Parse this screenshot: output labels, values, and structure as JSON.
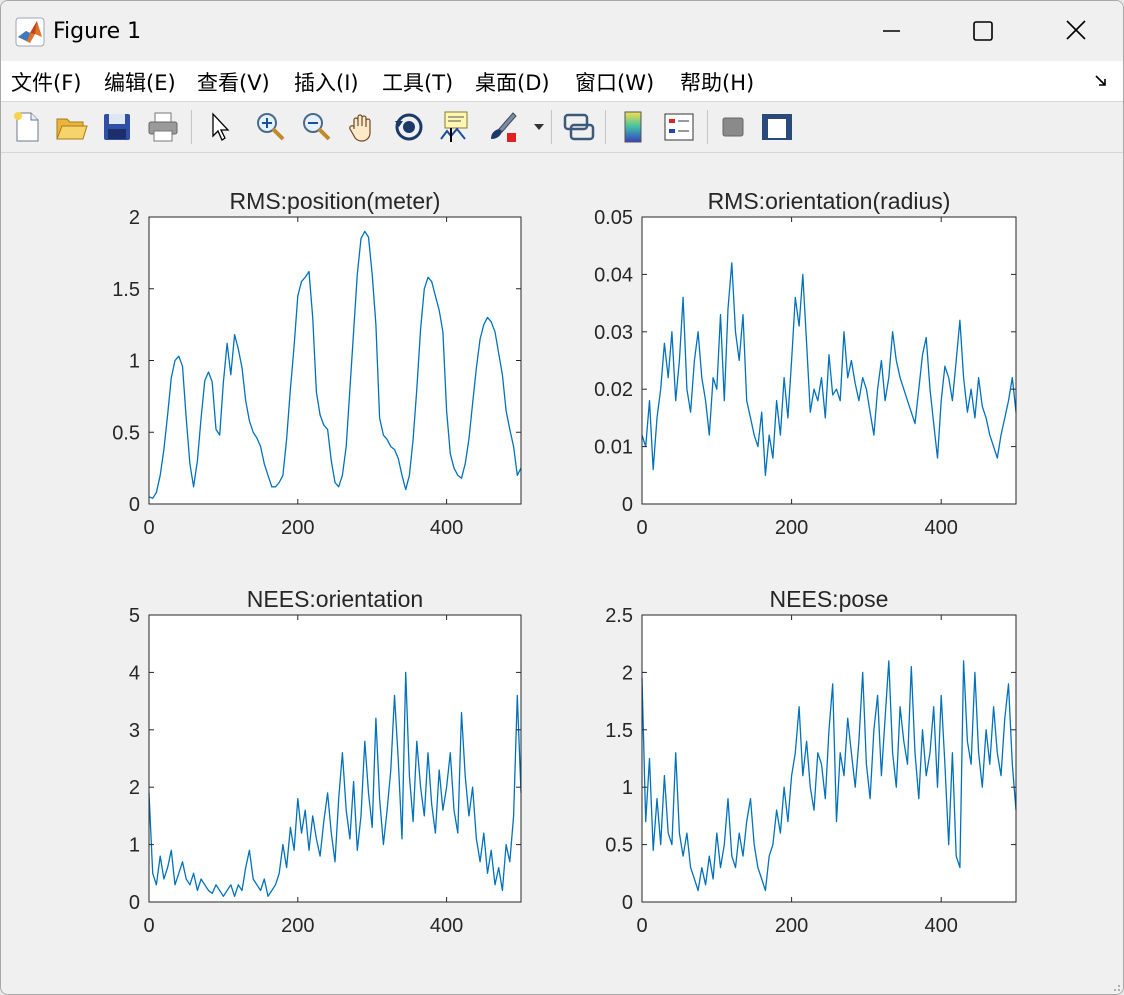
{
  "window": {
    "title": "Figure 1",
    "controls": {
      "minimize": "minimize",
      "maximize": "maximize",
      "close": "close"
    }
  },
  "menu": [
    {
      "label": "文件(F)"
    },
    {
      "label": "编辑(E)"
    },
    {
      "label": "查看(V)"
    },
    {
      "label": "插入(I)"
    },
    {
      "label": "工具(T)"
    },
    {
      "label": "桌面(D)"
    },
    {
      "label": "窗口(W)"
    },
    {
      "label": "帮助(H)"
    }
  ],
  "toolbar": [
    {
      "icon": "new-figure-icon"
    },
    {
      "icon": "open-file-icon"
    },
    {
      "icon": "save-icon"
    },
    {
      "icon": "print-icon"
    },
    {
      "icon": "select-arrow-icon"
    },
    {
      "icon": "zoom-in-icon"
    },
    {
      "icon": "zoom-out-icon"
    },
    {
      "icon": "pan-hand-icon"
    },
    {
      "icon": "rotate-3d-icon"
    },
    {
      "icon": "data-cursor-icon"
    },
    {
      "icon": "brush-icon"
    },
    {
      "icon": "link-plot-icon"
    },
    {
      "icon": "colorbar-icon"
    },
    {
      "icon": "legend-icon"
    },
    {
      "icon": "hide-plot-tools-icon"
    },
    {
      "icon": "show-plot-tools-icon"
    }
  ],
  "colors": {
    "line": "#0072BD",
    "axes_bg": "#ffffff",
    "axes_edge": "#262626",
    "figure_bg": "#f0f0f0"
  },
  "chart_data": [
    {
      "type": "line",
      "title": "RMS:position(meter)",
      "xlim": [
        0,
        500
      ],
      "ylim": [
        0,
        2
      ],
      "xticks": [
        0,
        200,
        400
      ],
      "yticks": [
        0,
        0.5,
        1,
        1.5,
        2
      ],
      "xtick_labels": [
        "0",
        "200",
        "400"
      ],
      "ytick_labels": [
        "0",
        "0.5",
        "1",
        "1.5",
        "2"
      ],
      "x": [
        0,
        5,
        10,
        15,
        20,
        25,
        30,
        35,
        40,
        45,
        50,
        55,
        60,
        65,
        70,
        75,
        80,
        85,
        90,
        95,
        100,
        105,
        110,
        115,
        120,
        125,
        130,
        135,
        140,
        145,
        150,
        155,
        160,
        165,
        170,
        175,
        180,
        185,
        190,
        195,
        200,
        205,
        210,
        215,
        220,
        225,
        230,
        235,
        240,
        245,
        250,
        255,
        260,
        265,
        270,
        275,
        280,
        285,
        290,
        295,
        300,
        305,
        310,
        315,
        320,
        325,
        330,
        335,
        340,
        345,
        350,
        355,
        360,
        365,
        370,
        375,
        380,
        385,
        390,
        395,
        400,
        405,
        410,
        415,
        420,
        425,
        430,
        435,
        440,
        445,
        450,
        455,
        460,
        465,
        470,
        475,
        480,
        485,
        490,
        495,
        500
      ],
      "y": [
        0.05,
        0.04,
        0.08,
        0.2,
        0.38,
        0.62,
        0.88,
        1.0,
        1.03,
        0.96,
        0.6,
        0.28,
        0.12,
        0.3,
        0.6,
        0.86,
        0.92,
        0.85,
        0.52,
        0.48,
        0.85,
        1.12,
        0.9,
        1.18,
        1.08,
        0.95,
        0.72,
        0.58,
        0.5,
        0.46,
        0.4,
        0.28,
        0.2,
        0.12,
        0.12,
        0.15,
        0.2,
        0.45,
        0.8,
        1.1,
        1.45,
        1.55,
        1.58,
        1.62,
        1.3,
        0.78,
        0.62,
        0.55,
        0.52,
        0.3,
        0.15,
        0.12,
        0.2,
        0.4,
        0.8,
        1.2,
        1.6,
        1.85,
        1.9,
        1.86,
        1.6,
        1.25,
        0.6,
        0.48,
        0.45,
        0.4,
        0.38,
        0.32,
        0.2,
        0.1,
        0.2,
        0.45,
        0.8,
        1.22,
        1.5,
        1.58,
        1.55,
        1.45,
        1.35,
        1.2,
        0.65,
        0.35,
        0.25,
        0.2,
        0.18,
        0.28,
        0.45,
        0.7,
        0.95,
        1.15,
        1.25,
        1.3,
        1.27,
        1.2,
        1.05,
        0.9,
        0.65,
        0.52,
        0.4,
        0.2,
        0.25
      ]
    },
    {
      "type": "line",
      "title": "RMS:orientation(radius)",
      "xlim": [
        0,
        500
      ],
      "ylim": [
        0,
        0.05
      ],
      "xticks": [
        0,
        200,
        400
      ],
      "yticks": [
        0,
        0.01,
        0.02,
        0.03,
        0.04,
        0.05
      ],
      "xtick_labels": [
        "0",
        "200",
        "400"
      ],
      "ytick_labels": [
        "0",
        "0.01",
        "0.02",
        "0.03",
        "0.04",
        "0.05"
      ],
      "x": [
        0,
        5,
        10,
        15,
        20,
        25,
        30,
        35,
        40,
        45,
        50,
        55,
        60,
        65,
        70,
        75,
        80,
        85,
        90,
        95,
        100,
        105,
        110,
        115,
        120,
        125,
        130,
        135,
        140,
        145,
        150,
        155,
        160,
        165,
        170,
        175,
        180,
        185,
        190,
        195,
        200,
        205,
        210,
        215,
        220,
        225,
        230,
        235,
        240,
        245,
        250,
        255,
        260,
        265,
        270,
        275,
        280,
        285,
        290,
        295,
        300,
        305,
        310,
        315,
        320,
        325,
        330,
        335,
        340,
        345,
        350,
        355,
        360,
        365,
        370,
        375,
        380,
        385,
        390,
        395,
        400,
        405,
        410,
        415,
        420,
        425,
        430,
        435,
        440,
        445,
        450,
        455,
        460,
        465,
        470,
        475,
        480,
        485,
        490,
        495,
        500
      ],
      "y": [
        0.012,
        0.01,
        0.018,
        0.006,
        0.015,
        0.02,
        0.028,
        0.022,
        0.03,
        0.018,
        0.025,
        0.036,
        0.02,
        0.016,
        0.025,
        0.03,
        0.022,
        0.018,
        0.012,
        0.022,
        0.02,
        0.033,
        0.018,
        0.034,
        0.042,
        0.03,
        0.025,
        0.033,
        0.018,
        0.015,
        0.012,
        0.01,
        0.016,
        0.005,
        0.012,
        0.008,
        0.018,
        0.012,
        0.022,
        0.015,
        0.025,
        0.036,
        0.031,
        0.04,
        0.028,
        0.016,
        0.02,
        0.018,
        0.022,
        0.015,
        0.026,
        0.019,
        0.02,
        0.018,
        0.03,
        0.022,
        0.025,
        0.021,
        0.018,
        0.022,
        0.02,
        0.016,
        0.012,
        0.02,
        0.025,
        0.018,
        0.022,
        0.03,
        0.025,
        0.022,
        0.02,
        0.018,
        0.016,
        0.014,
        0.02,
        0.026,
        0.029,
        0.02,
        0.014,
        0.008,
        0.018,
        0.024,
        0.022,
        0.018,
        0.025,
        0.032,
        0.022,
        0.016,
        0.02,
        0.015,
        0.022,
        0.017,
        0.015,
        0.012,
        0.01,
        0.008,
        0.012,
        0.015,
        0.018,
        0.022,
        0.016
      ]
    },
    {
      "type": "line",
      "title": "NEES:orientation",
      "xlim": [
        0,
        500
      ],
      "ylim": [
        0,
        5
      ],
      "xticks": [
        0,
        200,
        400
      ],
      "yticks": [
        0,
        1,
        2,
        3,
        4,
        5
      ],
      "xtick_labels": [
        "0",
        "200",
        "400"
      ],
      "ytick_labels": [
        "0",
        "1",
        "2",
        "3",
        "4",
        "5"
      ],
      "x": [
        0,
        5,
        10,
        15,
        20,
        25,
        30,
        35,
        40,
        45,
        50,
        55,
        60,
        65,
        70,
        75,
        80,
        85,
        90,
        95,
        100,
        105,
        110,
        115,
        120,
        125,
        130,
        135,
        140,
        145,
        150,
        155,
        160,
        165,
        170,
        175,
        180,
        185,
        190,
        195,
        200,
        205,
        210,
        215,
        220,
        225,
        230,
        235,
        240,
        245,
        250,
        255,
        260,
        265,
        270,
        275,
        280,
        285,
        290,
        295,
        300,
        305,
        310,
        315,
        320,
        325,
        330,
        335,
        340,
        345,
        350,
        355,
        360,
        365,
        370,
        375,
        380,
        385,
        390,
        395,
        400,
        405,
        410,
        415,
        420,
        425,
        430,
        435,
        440,
        445,
        450,
        455,
        460,
        465,
        470,
        475,
        480,
        485,
        490,
        495,
        500
      ],
      "y": [
        1.9,
        0.5,
        0.3,
        0.8,
        0.4,
        0.6,
        0.9,
        0.3,
        0.5,
        0.7,
        0.4,
        0.3,
        0.5,
        0.2,
        0.4,
        0.3,
        0.2,
        0.15,
        0.3,
        0.2,
        0.1,
        0.2,
        0.3,
        0.1,
        0.3,
        0.2,
        0.6,
        0.9,
        0.4,
        0.3,
        0.2,
        0.4,
        0.1,
        0.2,
        0.3,
        0.5,
        1.0,
        0.6,
        1.3,
        0.9,
        1.8,
        1.2,
        1.6,
        0.9,
        1.5,
        1.1,
        0.8,
        1.4,
        1.9,
        1.2,
        0.7,
        1.8,
        2.6,
        1.6,
        1.1,
        2.1,
        0.9,
        1.5,
        2.8,
        1.9,
        1.3,
        3.2,
        1.8,
        1.0,
        1.6,
        2.3,
        3.6,
        2.5,
        1.1,
        4.0,
        2.2,
        1.4,
        2.8,
        2.0,
        1.5,
        2.6,
        1.7,
        1.2,
        2.3,
        1.6,
        2.0,
        2.6,
        1.6,
        1.2,
        3.3,
        2.2,
        1.5,
        2.0,
        1.1,
        0.7,
        1.2,
        0.5,
        0.9,
        0.3,
        0.6,
        0.2,
        1.0,
        0.7,
        1.5,
        3.6,
        1.9
      ]
    },
    {
      "type": "line",
      "title": "NEES:pose",
      "xlim": [
        0,
        500
      ],
      "ylim": [
        0,
        2.5
      ],
      "xticks": [
        0,
        200,
        400
      ],
      "yticks": [
        0,
        0.5,
        1,
        1.5,
        2,
        2.5
      ],
      "xtick_labels": [
        "0",
        "200",
        "400"
      ],
      "ytick_labels": [
        "0",
        "0.5",
        "1",
        "1.5",
        "2",
        "2.5"
      ],
      "x": [
        0,
        5,
        10,
        15,
        20,
        25,
        30,
        35,
        40,
        45,
        50,
        55,
        60,
        65,
        70,
        75,
        80,
        85,
        90,
        95,
        100,
        105,
        110,
        115,
        120,
        125,
        130,
        135,
        140,
        145,
        150,
        155,
        160,
        165,
        170,
        175,
        180,
        185,
        190,
        195,
        200,
        205,
        210,
        215,
        220,
        225,
        230,
        235,
        240,
        245,
        250,
        255,
        260,
        265,
        270,
        275,
        280,
        285,
        290,
        295,
        300,
        305,
        310,
        315,
        320,
        325,
        330,
        335,
        340,
        345,
        350,
        355,
        360,
        365,
        370,
        375,
        380,
        385,
        390,
        395,
        400,
        405,
        410,
        415,
        420,
        425,
        430,
        435,
        440,
        445,
        450,
        455,
        460,
        465,
        470,
        475,
        480,
        485,
        490,
        495,
        500
      ],
      "y": [
        1.95,
        0.7,
        1.25,
        0.45,
        0.9,
        0.5,
        1.1,
        0.6,
        0.5,
        1.3,
        0.6,
        0.4,
        0.6,
        0.3,
        0.2,
        0.1,
        0.3,
        0.15,
        0.4,
        0.2,
        0.6,
        0.3,
        0.5,
        0.9,
        0.4,
        0.3,
        0.6,
        0.4,
        0.7,
        0.9,
        0.5,
        0.3,
        0.2,
        0.1,
        0.4,
        0.5,
        0.8,
        0.6,
        1.0,
        0.7,
        1.1,
        1.3,
        1.7,
        1.1,
        1.4,
        1.0,
        0.8,
        1.3,
        1.2,
        0.9,
        1.5,
        1.9,
        0.7,
        1.3,
        1.1,
        1.6,
        1.3,
        1.0,
        1.4,
        2.0,
        1.2,
        0.9,
        1.5,
        1.8,
        1.1,
        1.6,
        2.1,
        1.3,
        1.0,
        1.7,
        1.4,
        1.2,
        2.05,
        1.3,
        0.9,
        1.5,
        1.1,
        1.3,
        1.7,
        1.0,
        1.8,
        1.2,
        0.5,
        1.3,
        0.4,
        0.3,
        2.1,
        1.4,
        1.2,
        2.0,
        1.3,
        1.0,
        1.5,
        1.2,
        1.7,
        1.3,
        1.1,
        1.6,
        1.9,
        1.2,
        0.8
      ]
    }
  ]
}
